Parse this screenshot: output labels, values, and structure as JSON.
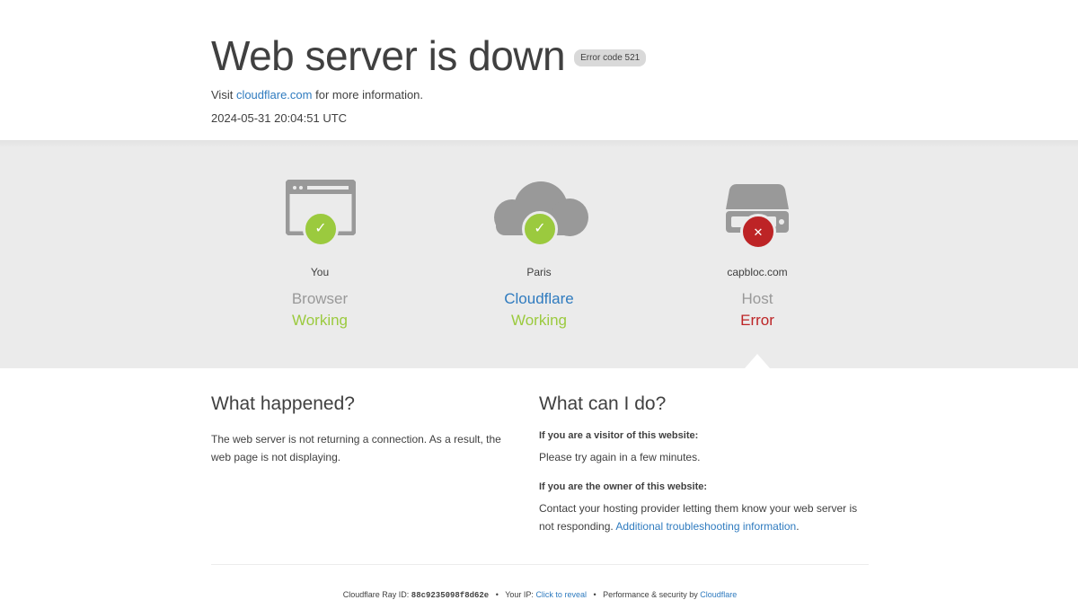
{
  "header": {
    "title": "Web server is down",
    "error_badge": "Error code 521",
    "visit_prefix": "Visit ",
    "visit_link": "cloudflare.com",
    "visit_suffix": " for more information.",
    "timestamp": "2024-05-31 20:04:51 UTC"
  },
  "status_columns": [
    {
      "location": "You",
      "role": "Browser",
      "status": "Working",
      "state": "ok",
      "icon": "browser-icon"
    },
    {
      "location": "Paris",
      "role": "Cloudflare",
      "status": "Working",
      "state": "ok",
      "icon": "cloud-icon"
    },
    {
      "location": "capbloc.com",
      "role": "Host",
      "status": "Error",
      "state": "error",
      "icon": "server-icon"
    }
  ],
  "what_happened": {
    "heading": "What happened?",
    "text": "The web server is not returning a connection. As a result, the web page is not displaying."
  },
  "what_can_i_do": {
    "heading": "What can I do?",
    "visitor_heading": "If you are a visitor of this website:",
    "visitor_text": "Please try again in a few minutes.",
    "owner_heading": "If you are the owner of this website:",
    "owner_text": "Contact your hosting provider letting them know your web server is not responding. ",
    "owner_link": "Additional troubleshooting information",
    "owner_suffix": "."
  },
  "footer": {
    "ray_label": "Cloudflare Ray ID: ",
    "ray_id": "88c9235098f8d62e",
    "ip_label": "Your IP: ",
    "ip_link": "Click to reveal",
    "perf_label": "Performance & security by ",
    "perf_link": "Cloudflare",
    "separator": "•"
  },
  "colors": {
    "ok": "#9bca3e",
    "error": "#bd2426",
    "link": "#2f7bbf",
    "band": "#ebebeb",
    "icon_gray": "#999999"
  }
}
